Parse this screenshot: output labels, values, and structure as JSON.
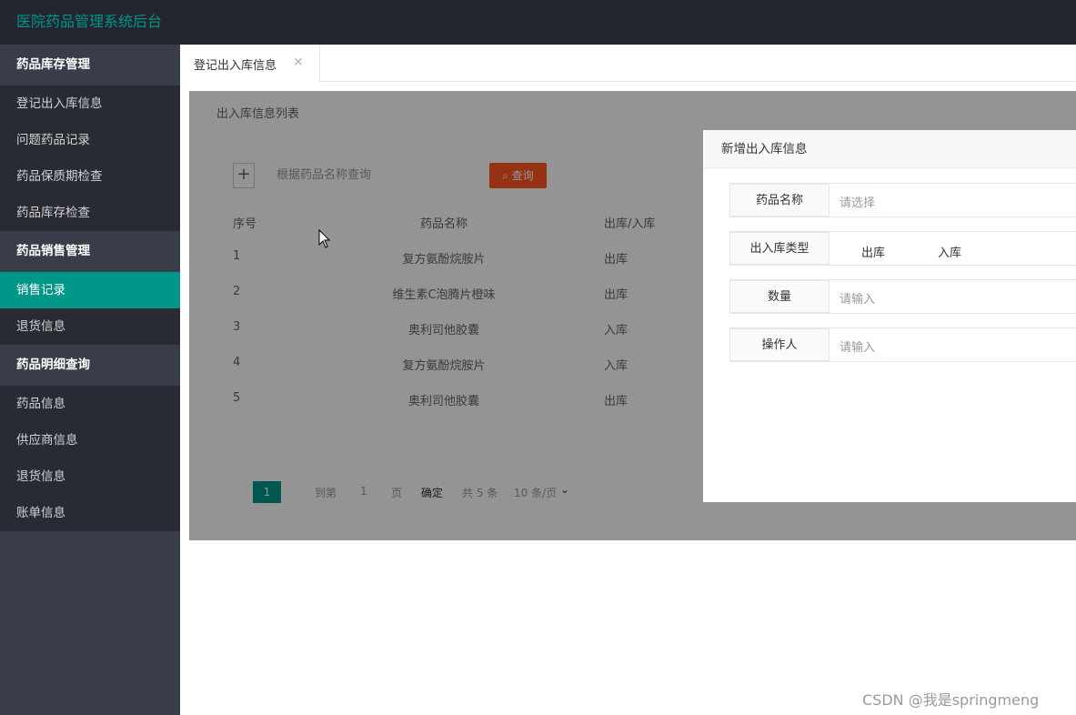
{
  "app": {
    "title": "医院药品管理系统后台"
  },
  "sidebar": {
    "groups": [
      {
        "label": "药品库存管理",
        "items": [
          "登记出入库信息",
          "问题药品记录",
          "药品保质期检查",
          "药品库存检查"
        ]
      },
      {
        "label": "药品销售管理",
        "items": [
          "销售记录",
          "退货信息"
        ]
      },
      {
        "label": "药品明细查询",
        "items": [
          "药品信息",
          "供应商信息",
          "退货信息",
          "账单信息"
        ]
      }
    ],
    "active_item": "销售记录"
  },
  "tabs": [
    {
      "label": "登记出入库信息",
      "close": "×"
    }
  ],
  "page": {
    "card_title": "出入库信息列表",
    "add_label": "+",
    "search_placeholder": "根据药品名称查询",
    "search_button": "查询",
    "table": {
      "headers": [
        "序号",
        "药品名称",
        "出库/入库"
      ],
      "rows": [
        [
          "1",
          "复方氨酚烷胺片",
          "出库"
        ],
        [
          "2",
          "维生素C泡腾片橙味",
          "出库"
        ],
        [
          "3",
          "奥利司他胶囊",
          "入库"
        ],
        [
          "4",
          "复方氨酚烷胺片",
          "入库"
        ],
        [
          "5",
          "奥利司他胶囊",
          "出库"
        ]
      ]
    },
    "pagination": {
      "current": "1",
      "goto_prefix": "到第",
      "goto_value": "1",
      "goto_suffix": "页",
      "confirm": "确定",
      "total": "共 5 条",
      "page_size": "10 条/页"
    }
  },
  "modal": {
    "title": "新增出入库信息",
    "fields": [
      {
        "label": "药品名称",
        "placeholder": "请选择"
      },
      {
        "label": "出入库类型",
        "options": [
          "出库",
          "入库"
        ]
      },
      {
        "label": "数量",
        "placeholder": "请输入"
      },
      {
        "label": "操作人",
        "placeholder": "请输入"
      }
    ]
  },
  "watermark": "CSDN @我是springmeng"
}
